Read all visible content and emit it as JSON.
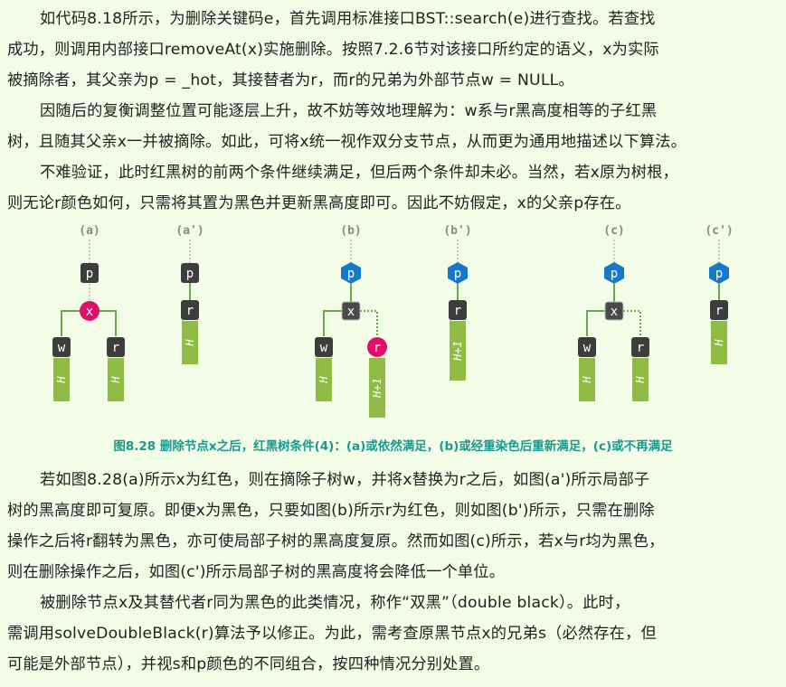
{
  "paragraphs": [
    {
      "id": "p1",
      "lines": [
        {
          "indent": true,
          "text": "如代码8.18所示，为删除关键码e，首先调用标准接口BST::search(e)进行查找。若查找"
        },
        {
          "indent": false,
          "text": "成功，则调用内部接口removeAt(x)实施删除。按照7.2.6节对该接口所约定的语义，x为实际"
        },
        {
          "indent": false,
          "text": "被摘除者，其父亲为p = _hot，其接替者为r，而r的兄弟为外部节点w = NULL。"
        }
      ]
    },
    {
      "id": "p2",
      "lines": [
        {
          "indent": true,
          "text": "因随后的复衡调整位置可能逐层上升，故不妨等效地理解为：w系与r黑高度相等的子红黑"
        },
        {
          "indent": false,
          "text": "树，且随其父亲x一并被摘除。如此，可将x统一视作双分支节点，从而更为通用地描述以下算法。"
        }
      ]
    },
    {
      "id": "p3",
      "lines": [
        {
          "indent": true,
          "text": "不难验证，此时红黑树的前两个条件继续满足，但后两个条件却未必。当然，若x原为树根，"
        },
        {
          "indent": false,
          "text": "则无论r颜色如何，只需将其置为黑色并更新黑高度即可。因此不妨假定，x的父亲p存在。"
        }
      ]
    },
    {
      "id": "p4",
      "lines": [
        {
          "indent": true,
          "text": "若如图8.28(a)所示x为红色，则在摘除子树w，并将x替换为r之后，如图(a')所示局部子"
        },
        {
          "indent": false,
          "text": "树的黑高度即可复原。即便x为黑色，只要如图(b)所示r为红色，则如图(b')所示，只需在删除"
        },
        {
          "indent": false,
          "text": "操作之后将r翻转为黑色，亦可使局部子树的黑高度复原。然而如图(c)所示，若x与r均为黑色，"
        },
        {
          "indent": false,
          "text": "则在删除操作之后，如图(c')所示局部子树的黑高度将会降低一个单位。"
        }
      ]
    },
    {
      "id": "p5",
      "lines": [
        {
          "indent": true,
          "text": "被删除节点x及其替代者r同为黑色的此类情况，称作“双黑”（double black）。此时，"
        },
        {
          "indent": false,
          "text": "需调用solveDoubleBlack(r)算法予以修正。为此，需考查原黑节点x的兄弟s（必然存在，但"
        },
        {
          "indent": false,
          "text": "可能是外部节点），并视s和p颜色的不同组合，按四种情况分别处置。"
        }
      ]
    }
  ],
  "figure": {
    "caption": "图8.28  删除节点x之后，红黑树条件(4)：(a)或依然满足，(b)或经重染色后重新满足，(c)或不再满足",
    "labels": {
      "a": "(a)",
      "a2": "(a')",
      "b": "(b)",
      "b2": "(b')",
      "c": "(c)",
      "c2": "(c')"
    },
    "node_names": {
      "p": "p",
      "x": "x",
      "w": "w",
      "r": "r"
    },
    "subtree_heights": {
      "h": "H",
      "h1": "H+1"
    },
    "colors": {
      "black_node": "#3d3d3d",
      "red_node": "#e0106a",
      "blue_node": "#1778c8",
      "x_black_node": "#4a4a4a",
      "subtree": "#8fbc45",
      "edge": "#6aa84f",
      "label": "#8a8a8a"
    }
  }
}
